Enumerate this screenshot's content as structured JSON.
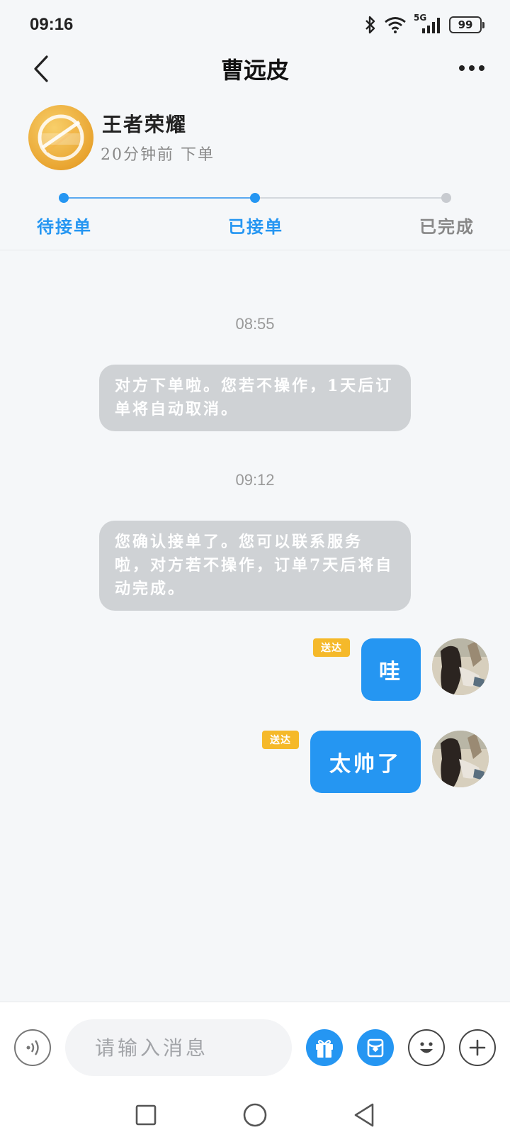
{
  "status_bar": {
    "time": "09:16",
    "network": "5G",
    "battery": "99"
  },
  "header": {
    "title": "曹远皮"
  },
  "order": {
    "game_name": "王者荣耀",
    "order_time": "20分钟前 下单",
    "steps": [
      {
        "label": "待接单",
        "active": true
      },
      {
        "label": "已接单",
        "active": true
      },
      {
        "label": "已完成",
        "active": false
      }
    ]
  },
  "chat": {
    "messages": [
      {
        "type": "time",
        "text": "08:55"
      },
      {
        "type": "system",
        "text": "对方下单啦。您若不操作，1天后订单将自动取消。"
      },
      {
        "type": "time",
        "text": "09:12"
      },
      {
        "type": "system",
        "text": "您确认接单了。您可以联系服务啦，对方若不操作，订单7天后将自动完成。"
      },
      {
        "type": "outgoing",
        "text": "哇",
        "status": "送达"
      },
      {
        "type": "outgoing",
        "text": "太帅了",
        "status": "送达"
      }
    ]
  },
  "input_bar": {
    "placeholder": "请输入消息"
  },
  "icons": {
    "back": "chevron-left-icon",
    "more": "more-dots-icon",
    "voice": "voice-icon",
    "gift": "gift-icon",
    "envelope": "red-packet-icon",
    "emoji": "emoji-icon",
    "plus": "plus-icon"
  },
  "colors": {
    "accent": "#2596f2",
    "delivered_tag": "#f5b92a",
    "system_bubble": "#cfd2d5",
    "inactive": "#999999"
  }
}
